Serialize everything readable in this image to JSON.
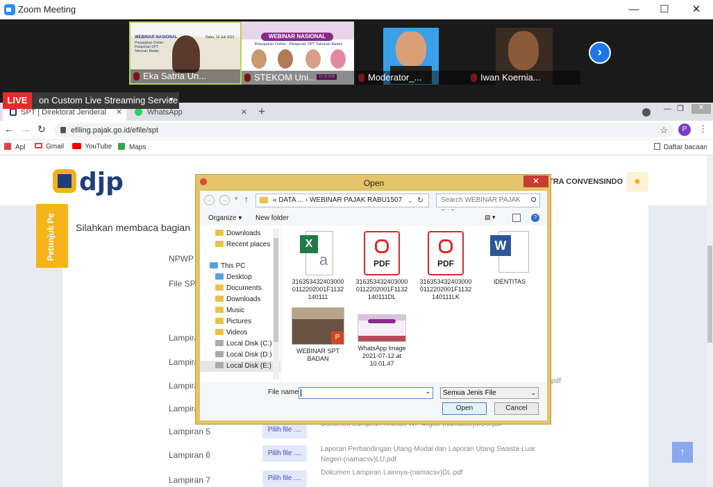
{
  "zoom": {
    "title": "Zoom Meeting",
    "min": "—",
    "max": "☐",
    "close": "✕"
  },
  "gallery": {
    "tiles": [
      {
        "name": "Eka Satria Un..."
      },
      {
        "name": "STEKOM Uni..."
      },
      {
        "name": "Moderator_..."
      },
      {
        "name": "Iwan Koernia..."
      }
    ],
    "slide1": {
      "title": "WEBINAR NASIONAL",
      "sub": "Perpajakan Online : Pelaporan SPT Tahunan Badan",
      "date": "Rabu, 14 Juli 2021"
    },
    "slide2": {
      "title": "WEBINAR NASIONAL",
      "sub": "Perpajakan Online : Pelaporan SPT Tahunan Badan",
      "time": "15.30 WIB"
    },
    "next": "›"
  },
  "live": {
    "badge": "LIVE",
    "text": "on Custom Live Streaming Service",
    "caret": "▾"
  },
  "browser": {
    "tabs": [
      {
        "label": "SPT | Direktorat Jenderal Pajak",
        "close": "✕"
      },
      {
        "label": "WhatsApp",
        "close": "✕"
      }
    ],
    "newtab": "+",
    "url": "efiling.pajak.go.id/efile/spt",
    "avatar": "P",
    "bookmarks": [
      "Apl",
      "Gmail",
      "YouTube",
      "Maps"
    ],
    "reading_list": "Daftar bacaan"
  },
  "page": {
    "logo": "djp",
    "user": "TRA CONVENSINDO",
    "petunjuk": "Petunjuk Pe",
    "intro": "Silahkan membaca bagian",
    "fields": [
      "NPWP",
      "File SPT"
    ],
    "lampiran": [
      "Lampiran",
      "Lampiran",
      "Lampiran",
      "Lampiran",
      "Lampiran 5",
      "Lampiran 6",
      "Lampiran 7"
    ],
    "pilih_label": "Pilih file ....",
    "descs": [
      "Dokumen Lampiran Khusus WP Migas-(namacsv)MGS.pdf",
      "Laporan Perbandingan Utang-Modal dan Laporan Utang Swasta-Luar Negeri-(namacsv)LU.pdf",
      "Dokumen Lampiran Lainnya-(namacsv)DL.pdf"
    ],
    "desc_frag": "pdf"
  },
  "dialog": {
    "title": "Open",
    "close": "✕",
    "path": "« DATA ...  ›  WEBINAR PAJAK RABU1507",
    "search_placeholder": "Search WEBINAR PAJAK RAB...",
    "organize": "Organize ▾",
    "new_folder": "New folder",
    "tree": [
      "Downloads",
      "Recent places",
      "This PC",
      "Desktop",
      "Documents",
      "Downloads",
      "Music",
      "Pictures",
      "Videos",
      "Local Disk (C:)",
      "Local Disk (D:)",
      "Local Disk (E:)"
    ],
    "files": [
      {
        "name": "316353432403000 0112202001F1132 140111",
        "icon": "excel-csv-icon"
      },
      {
        "name": "316353432403000 0112202001F1132 140111DL",
        "icon": "pdf-icon",
        "tag": "PDF"
      },
      {
        "name": "316353432403000 0112202001F1132 140111LK",
        "icon": "pdf-icon",
        "tag": "PDF"
      },
      {
        "name": "IDENTITAS",
        "icon": "word-doc-icon"
      },
      {
        "name": "WEBINAR SPT BADAN",
        "icon": "pptx-thumbnail-icon"
      },
      {
        "name": "WhatsApp Image 2021-07-12 at 10.01.47",
        "icon": "image-thumbnail-icon"
      }
    ],
    "filename_label": "File name:",
    "filename_value": "",
    "filetype": "Semua Jenis File",
    "open_btn": "Open",
    "cancel_btn": "Cancel"
  }
}
